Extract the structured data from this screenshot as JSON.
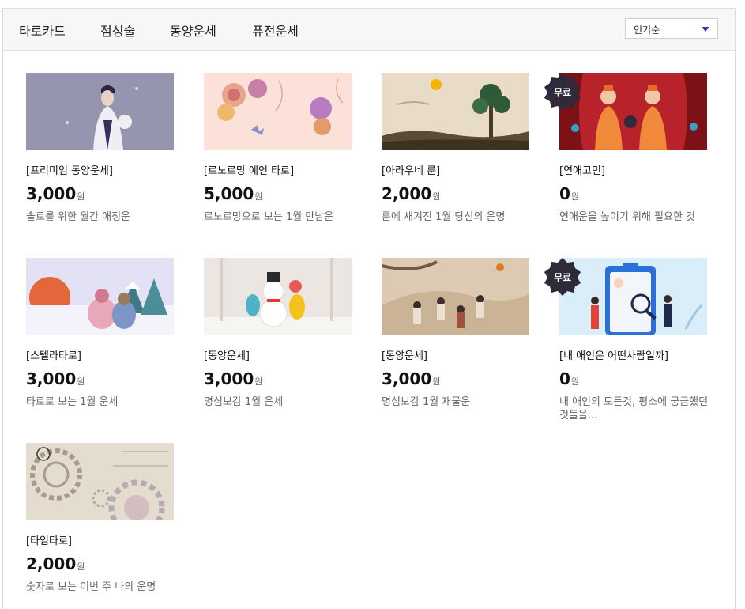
{
  "tabs": [
    "타로카드",
    "점성술",
    "동양운세",
    "퓨전운세"
  ],
  "sort": {
    "selected": "인기순"
  },
  "currency_unit": "원",
  "products": [
    {
      "title": "[프리미엄 동양운세]",
      "price": "3,000",
      "desc": "솔로를 위한 월간 애정운",
      "badge": ""
    },
    {
      "title": "[르노르망 예언 타로]",
      "price": "5,000",
      "desc": "르노르망으로 보는 1월 만남운",
      "badge": ""
    },
    {
      "title": "[아라우네 룬]",
      "price": "2,000",
      "desc": "룬에 새겨진 1월 당신의 운명",
      "badge": ""
    },
    {
      "title": "[연애고민]",
      "price": "0",
      "desc": "연애운을 높이기 위해 필요한 것",
      "badge": "무료"
    },
    {
      "title": "[스텔라타로]",
      "price": "3,000",
      "desc": "타로로 보는 1월 운세",
      "badge": ""
    },
    {
      "title": "[동양운세]",
      "price": "3,000",
      "desc": "명심보감 1월 운세",
      "badge": ""
    },
    {
      "title": "[동양운세]",
      "price": "3,000",
      "desc": "명심보감 1월 재물운",
      "badge": ""
    },
    {
      "title": "[내 애인은 어떤사람일까]",
      "price": "0",
      "desc": "내 애인의 모든것, 평소에 궁금했던 것들을...",
      "badge": "무료"
    },
    {
      "title": "[타임타로]",
      "price": "2,000",
      "desc": "숫자로 보는 이번 주 나의 운명",
      "badge": ""
    }
  ]
}
